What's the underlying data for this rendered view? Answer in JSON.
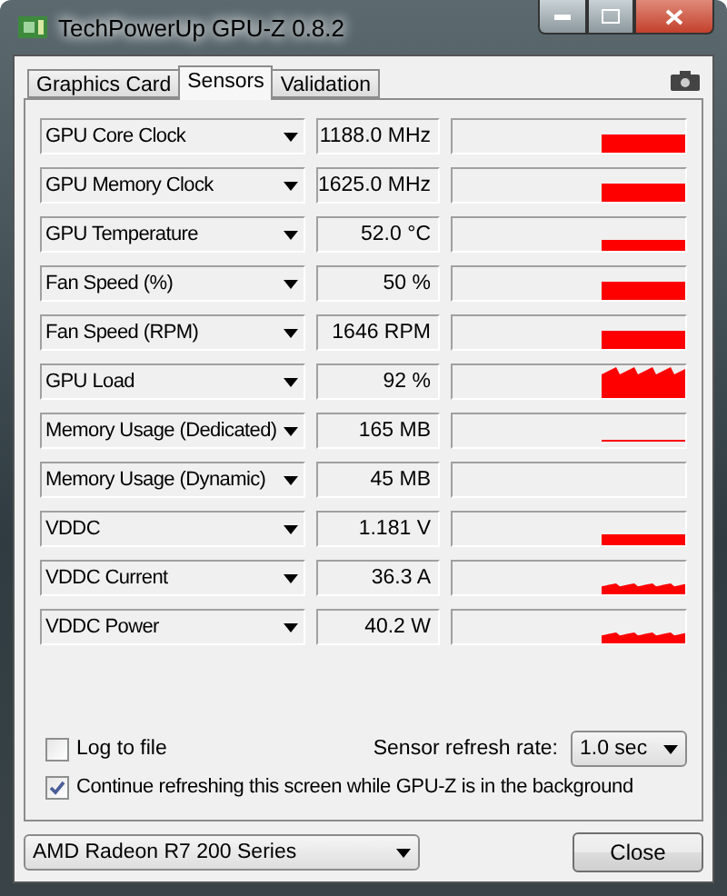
{
  "window": {
    "title": "TechPowerUp GPU-Z 0.8.2"
  },
  "tabs": [
    {
      "label": "Graphics Card",
      "selected": false
    },
    {
      "label": "Sensors",
      "selected": true
    },
    {
      "label": "Validation",
      "selected": false
    }
  ],
  "sensors": [
    {
      "name": "GPU Core Clock",
      "value": "1188.0 MHz",
      "kind": "solid"
    },
    {
      "name": "GPU Memory Clock",
      "value": "1625.0 MHz",
      "kind": "solid"
    },
    {
      "name": "GPU Temperature",
      "value": "52.0 °C",
      "kind": "low"
    },
    {
      "name": "Fan Speed (%)",
      "value": "50 %",
      "kind": "solid"
    },
    {
      "name": "Fan Speed (RPM)",
      "value": "1646 RPM",
      "kind": "solid"
    },
    {
      "name": "GPU Load",
      "value": "92 %",
      "kind": "noisy"
    },
    {
      "name": "Memory Usage (Dedicated)",
      "value": "165 MB",
      "kind": "line"
    },
    {
      "name": "Memory Usage (Dynamic)",
      "value": "45 MB",
      "kind": "empty"
    },
    {
      "name": "VDDC",
      "value": "1.181 V",
      "kind": "low"
    },
    {
      "name": "VDDC Current",
      "value": "36.3 A",
      "kind": "ragged"
    },
    {
      "name": "VDDC Power",
      "value": "40.2 W",
      "kind": "ragged"
    }
  ],
  "log_to_file": {
    "label": "Log to file",
    "checked": false
  },
  "refresh": {
    "label": "Sensor refresh rate:",
    "value": "1.0 sec"
  },
  "continue_refreshing": {
    "label": "Continue refreshing this screen while GPU-Z is in the background",
    "checked": true
  },
  "device": {
    "value": "AMD Radeon R7 200 Series"
  },
  "close_button": "Close"
}
